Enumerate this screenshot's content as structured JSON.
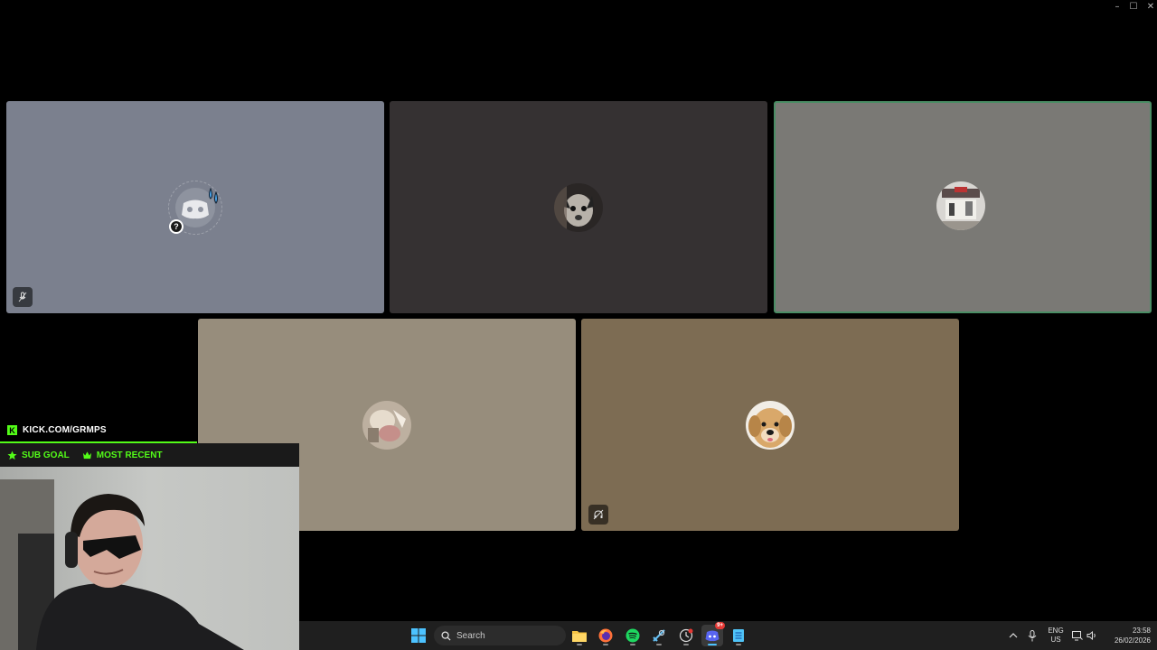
{
  "window": {
    "minimize": "–",
    "maximize": "☐",
    "close": "✕"
  },
  "tiles": [
    {
      "id": "user-1",
      "bg": "#7b808e",
      "status": "muted"
    },
    {
      "id": "user-2",
      "bg": "#353132",
      "status": "none"
    },
    {
      "id": "user-3",
      "bg": "#7a7975",
      "status": "speaking",
      "highlight": "#4a8d64"
    },
    {
      "id": "user-4",
      "bg": "#978d7c",
      "status": "none"
    },
    {
      "id": "user-5",
      "bg": "#7d6c53",
      "status": "deafened"
    }
  ],
  "overlay": {
    "kick_url": "KICK.COM/GRMPS",
    "sub_goal": "SUB GOAL",
    "most_recent": "MOST RECENT",
    "accent": "#53fc18"
  },
  "taskbar": {
    "search_placeholder": "Search",
    "apps": [
      "start-icon",
      "file-explorer-icon",
      "firefox-icon",
      "spotify-icon",
      "steam-icon",
      "clock-app-icon",
      "discord-icon",
      "notepad-icon"
    ],
    "discord_badge": "9+",
    "lang_line1": "ENG",
    "lang_line2": "US",
    "time": "23:58",
    "date": "26/02/2026"
  }
}
